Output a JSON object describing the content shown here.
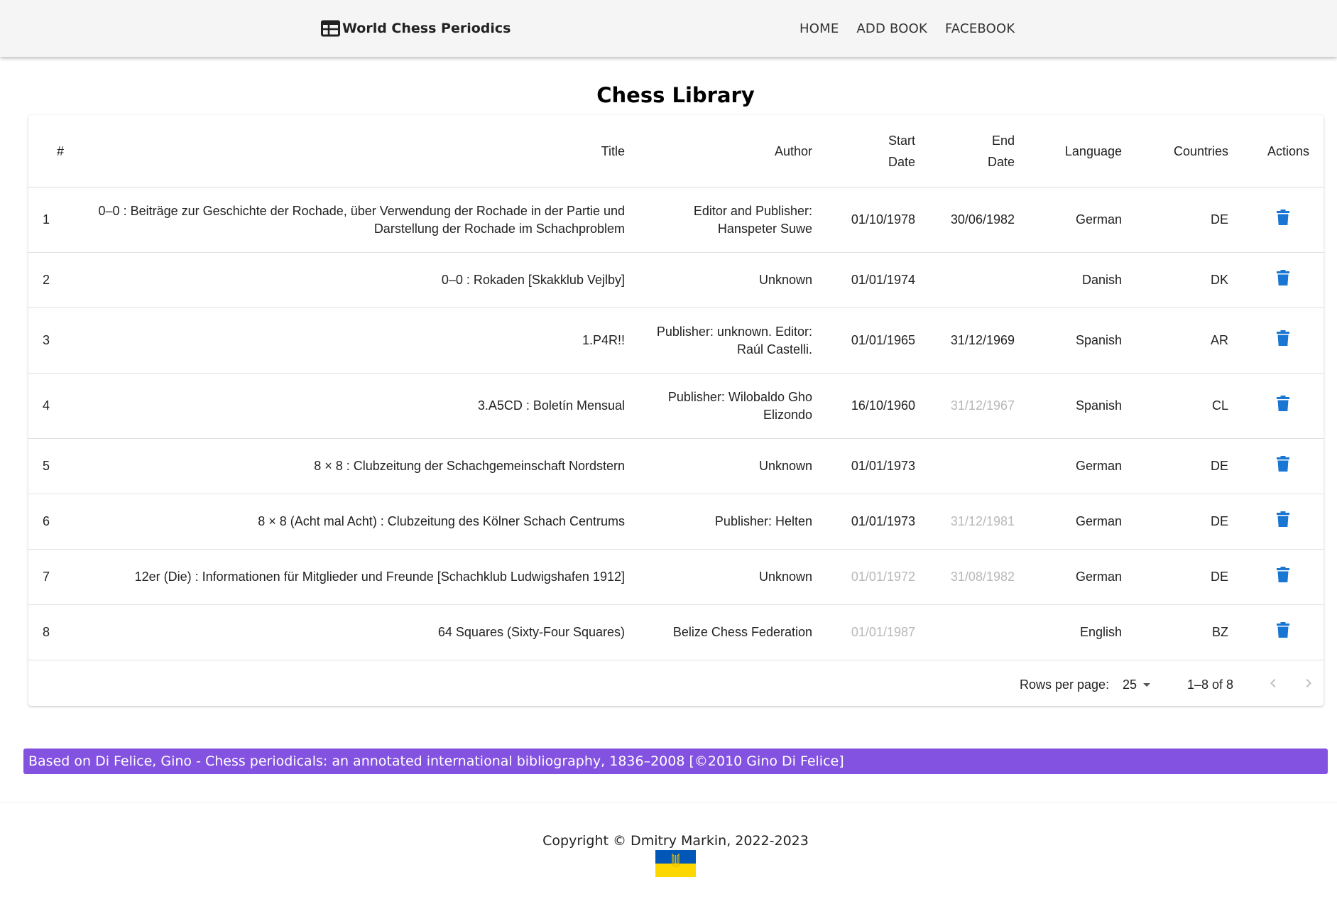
{
  "nav": {
    "brand": "World Chess Periodics",
    "brand_icon": "calendar-view-icon",
    "links": [
      "HOME",
      "ADD BOOK",
      "FACEBOOK"
    ]
  },
  "page": {
    "title": "Chess Library"
  },
  "table": {
    "headers": {
      "num": "#",
      "title": "Title",
      "author": "Author",
      "start_date_1": "Start",
      "start_date_2": "Date",
      "end_date_1": "End",
      "end_date_2": "Date",
      "language": "Language",
      "countries": "Countries",
      "actions": "Actions"
    },
    "action_icon": "trash-icon",
    "action_color": "#1976d2",
    "rows": [
      {
        "num": "1",
        "title_1": "0–0 : Beiträge zur Geschichte der Rochade, über Verwendung der Rochade in der Partie und",
        "title_2": "Darstellung der Rochade im Schachproblem",
        "author_1": "Editor and Publisher:",
        "author_2": "Hanspeter Suwe",
        "start": "01/10/1978",
        "end": "30/06/1982",
        "language": "German",
        "country": "DE"
      },
      {
        "num": "2",
        "title_1": "0–0 : Rokaden [Skakklub Vejlby]",
        "title_2": "",
        "author_1": "Unknown",
        "author_2": "",
        "start": "01/01/1974",
        "end": "",
        "language": "Danish",
        "country": "DK"
      },
      {
        "num": "3",
        "title_1": "1.P4R!!",
        "title_2": "",
        "author_1": "Publisher: unknown. Editor:",
        "author_2": "Raúl Castelli.",
        "start": "01/01/1965",
        "end": "31/12/1969",
        "language": "Spanish",
        "country": "AR"
      },
      {
        "num": "4",
        "title_1": "3.A5CD : Boletín Mensual",
        "title_2": "",
        "author_1": "Publisher: Wilobaldo Gho",
        "author_2": "Elizondo",
        "start": "16/10/1960",
        "end": "31/12/1967",
        "language": "Spanish",
        "country": "CL"
      },
      {
        "num": "5",
        "title_1": "8 × 8 : Clubzeitung der Schachgemeinschaft Nordstern",
        "title_2": "",
        "author_1": "Unknown",
        "author_2": "",
        "start": "01/01/1973",
        "end": "",
        "language": "German",
        "country": "DE"
      },
      {
        "num": "6",
        "title_1": "8 × 8 (Acht mal Acht) : Clubzeitung des Kölner Schach Centrums",
        "title_2": "",
        "author_1": "Publisher: Helten",
        "author_2": "",
        "start": "01/01/1973",
        "end": "31/12/1981",
        "language": "German",
        "country": "DE"
      },
      {
        "num": "7",
        "title_1": "12er (Die) : Informationen für Mitglieder und Freunde [Schachklub Ludwigshafen 1912]",
        "title_2": "",
        "author_1": "Unknown",
        "author_2": "",
        "start": "01/01/1972",
        "end": "31/08/1982",
        "language": "German",
        "country": "DE"
      },
      {
        "num": "8",
        "title_1": "64 Squares (Sixty-Four Squares)",
        "title_2": "",
        "author_1": "Belize Chess Federation",
        "author_2": "",
        "start": "01/01/1987",
        "end": "",
        "language": "English",
        "country": "BZ"
      }
    ]
  },
  "pagination": {
    "rows_per_page_label": "Rows per page:",
    "rows_per_page_value": "25",
    "range": "1–8 of 8"
  },
  "banner": {
    "text": "Based on Di Felice, Gino - Chess periodicals: an annotated international bibliography, 1836–2008 [©2010 Gino Di Felice]",
    "color": "#8452e1"
  },
  "footer": {
    "copyright": "Copyright © Dmitry Markin, 2022-2023",
    "flag_colors": [
      "#0057b7",
      "#ffd700"
    ]
  }
}
